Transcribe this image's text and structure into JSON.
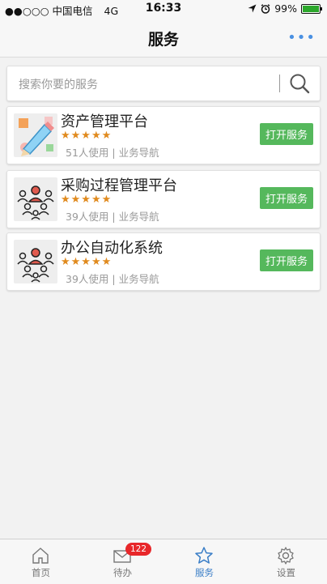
{
  "status_bar": {
    "carrier": "●●○○○ 中国电信",
    "network": "4G",
    "time": "16:33",
    "battery": "99%",
    "battery_level": 0.99
  },
  "nav": {
    "title": "服务",
    "more_label": "•••"
  },
  "search": {
    "placeholder": "搜索你要的服务"
  },
  "services": [
    {
      "name": "资产管理平台",
      "stars": "★★★★★",
      "usage": "51人使用",
      "category": "业务导航",
      "button": "打开服务",
      "icon": "pencil-icon"
    },
    {
      "name": "采购过程管理平台",
      "stars": "★★★★★",
      "usage": "39人使用",
      "category": "业务导航",
      "button": "打开服务",
      "icon": "people-network-icon"
    },
    {
      "name": "办公自动化系统",
      "stars": "★★★★★",
      "usage": "39人使用",
      "category": "业务导航",
      "button": "打开服务",
      "icon": "people-network-icon"
    }
  ],
  "tabs": [
    {
      "label": "首页",
      "icon": "home-icon"
    },
    {
      "label": "待办",
      "icon": "mail-icon",
      "badge": "122"
    },
    {
      "label": "服务",
      "icon": "star-icon",
      "active": true
    },
    {
      "label": "设置",
      "icon": "gear-icon"
    }
  ],
  "colors": {
    "accent": "#3a7ec7",
    "button_green": "#55b85c",
    "badge_red": "#e8272a",
    "star_orange": "#e08a1e"
  }
}
